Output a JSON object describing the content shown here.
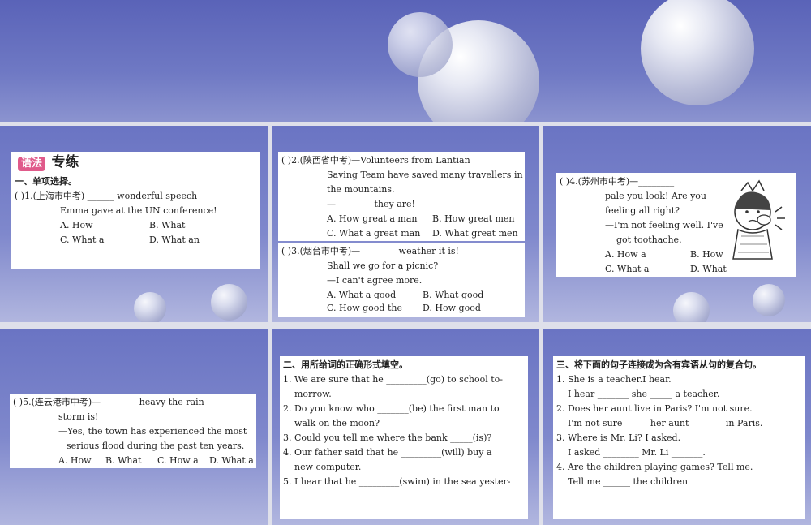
{
  "s1": {
    "tag": "语法",
    "title": "专练",
    "section": "一、单项选择。",
    "q1": {
      "paren": "(      )1.",
      "src": "(上海市中考)",
      "text": "______ wonderful speech",
      "line2": "Emma gave at the UN conference!",
      "a": "A. How",
      "b": "B. What",
      "c": "C. What a",
      "d": "D. What an"
    }
  },
  "s2": {
    "q2": {
      "paren": "(      )2.",
      "src": "(陕西省中考)",
      "text": "—Volunteers from Lantian",
      "l2": "Saving Team have saved many travellers in",
      "l3": "the mountains.",
      "l4": "—________ they are!",
      "a": "A. How great a man",
      "b": "B. How great men",
      "c": "C. What a great man",
      "d": "D. What great men"
    },
    "q3": {
      "paren": "(      )3.",
      "src": "(烟台市中考)",
      "text": "—________ weather it is!",
      "l2": "Shall we go for a picnic?",
      "l3": "—I can't agree more.",
      "a": "A. What a good",
      "b": "B. What good",
      "c": "C. How good the",
      "d": "D. How good"
    }
  },
  "s3": {
    "q4": {
      "paren": "(      )4.",
      "src": "(苏州市中考)",
      "text": "—________",
      "l2": "pale you look! Are you",
      "l3": "feeling all right?",
      "l4": "—I'm not feeling well. I've",
      "l5": "got toothache.",
      "a": "A. How a",
      "b": "B. How",
      "c": "C. What a",
      "d": "D. What"
    }
  },
  "s4": {
    "q5": {
      "paren": "(      )5.",
      "src": "(连云港市中考)",
      "text": "—________ heavy the rain",
      "l2": "storm is!",
      "l3": "—Yes, the town has experienced the most",
      "l4": "serious flood during the past ten years.",
      "a": "A. How",
      "b": "B. What",
      "c": "C. How a",
      "d": "D. What a"
    }
  },
  "s5": {
    "section": "二、用所给词的正确形式填空。",
    "items": [
      "1. We are sure that he _________(go) to school to-",
      "morrow.",
      "2. Do you know who _______(be) the first man to",
      "walk on the moon?",
      "3. Could you tell me where the bank _____(is)?",
      "4. Our father said that he _________(will) buy a",
      "new computer.",
      "5. I hear that he _________(swim) in the sea yester-"
    ]
  },
  "s6": {
    "section": "三、将下面的句子连接成为含有宾语从句的复合句。",
    "items": [
      "1. She is a teacher.I hear.",
      "I hear _______ she _____ a teacher.",
      "2. Does her aunt live in Paris? I'm not sure.",
      "I'm not sure _____ her aunt _______ in Paris.",
      "3. Where is Mr. Li? I asked.",
      "I asked ________ Mr. Li _______.",
      "4. Are the children playing games? Tell me.",
      "Tell me ______ the children"
    ]
  }
}
